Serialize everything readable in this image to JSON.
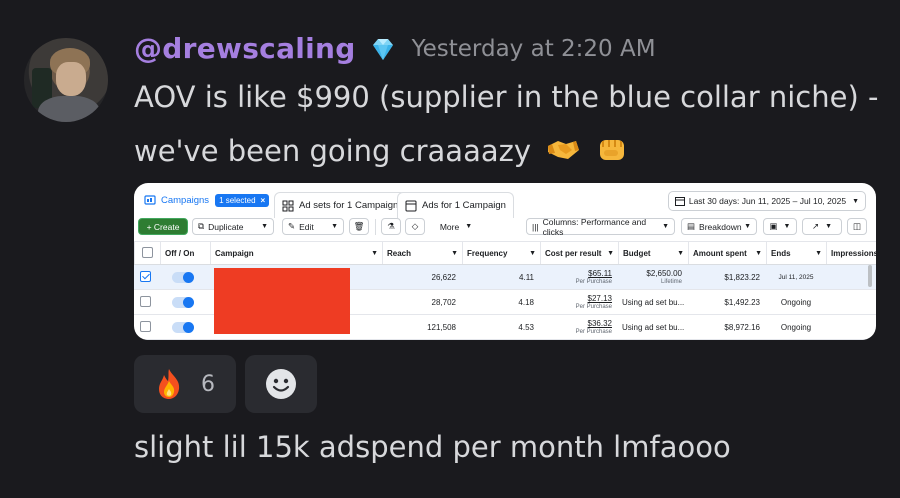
{
  "message": {
    "username": "@drewscaling",
    "badge_icon": "diamond-icon",
    "timestamp": "Yesterday at 2:20 AM",
    "line1": "AOV is like $990 (supplier in the blue collar niche) -",
    "line2": "we've been going craaaazy",
    "line2_emojis": [
      "handshake-icon",
      "fist-icon"
    ],
    "followup": "slight lil 15k adspend per month lmfaooo"
  },
  "reactions": [
    {
      "icon": "fire-icon",
      "count": "6"
    },
    {
      "icon": "add-reaction-icon",
      "count": ""
    }
  ],
  "screenshot": {
    "tabs": {
      "campaigns": "Campaigns",
      "selected_chip": "1 selected",
      "adsets": "Ad sets for 1 Campaign",
      "ads": "Ads for 1 Campaign"
    },
    "date_range": "Last 30 days: Jun 11, 2025 – Jul 10, 2025",
    "toolbar": {
      "create": "+ Create",
      "duplicate": "Duplicate",
      "edit": "Edit",
      "more": "More",
      "columns": "Columns: Performance and clicks",
      "breakdown": "Breakdown"
    },
    "columns": [
      "Off / On",
      "Campaign",
      "Reach",
      "Frequency",
      "Cost per result",
      "Budget",
      "Amount spent",
      "Ends",
      "Impressions"
    ],
    "rows": [
      {
        "reach": "26,622",
        "frequency": "4.11",
        "cost": "$65.11",
        "cost_sub": "Per Purchase",
        "budget": "$2,650.00",
        "budget_sub": "Lifetime",
        "spent": "$1,823.22",
        "ends": "Jul 11, 2025",
        "selected": true
      },
      {
        "reach": "28,702",
        "frequency": "4.18",
        "cost": "$27.13",
        "cost_sub": "Per Purchase",
        "budget": "Using ad set bu...",
        "budget_sub": "",
        "spent": "$1,492.23",
        "ends": "Ongoing",
        "selected": false
      },
      {
        "reach": "121,508",
        "frequency": "4.53",
        "cost": "$36.32",
        "cost_sub": "Per Purchase",
        "budget": "Using ad set bu...",
        "budget_sub": "",
        "spent": "$8,972.16",
        "ends": "Ongoing",
        "selected": false
      }
    ]
  }
}
